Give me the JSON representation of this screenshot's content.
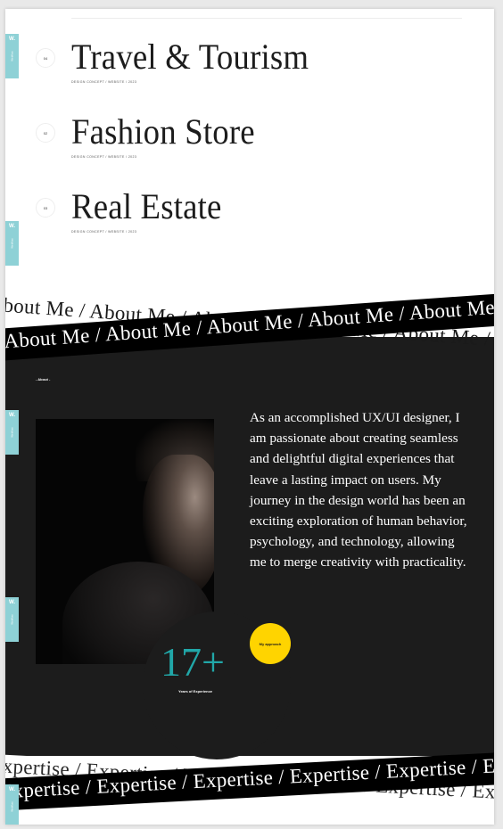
{
  "side_tab": {
    "logo": "W.",
    "label": "Webflow"
  },
  "projects": [
    {
      "number": "04",
      "title": "Travel & Tourism",
      "meta": "DESIGN CONCEPT  /  WEBSITE  /  2023"
    },
    {
      "number": "02",
      "title": "Fashion Store",
      "meta": "DESIGN CONCEPT  /  WEBSITE  /  2023"
    },
    {
      "number": "03",
      "title": "Real Estate",
      "meta": "DESIGN CONCEPT  /  WEBSITE  /  2023"
    }
  ],
  "about_band": {
    "front": "About Me  /  About Me  /  About Me  /  About Me  /  About Me  /  About Me",
    "back": "About Me  /  About Me  /  About Me  /  About Me  /  About Me  /  About Me"
  },
  "about": {
    "label": "- About -",
    "bio": "As an accomplished UX/UI designer, I am passionate about creating seamless and delightful digital experiences that leave a lasting impact on users. My journey in the design world has been an exciting exploration of human behavior, psychology, and technology, allowing me to merge creativity with practicality.",
    "button_label": "My approach",
    "years_value": "17+",
    "years_label": "Years of Experience",
    "photo_alt": "Portrait of designer"
  },
  "expertise_band": {
    "front": "Expertise  /  Expertise  /  Expertise  /  Expertise  /  Expertise  /  Expertise",
    "back": "Expertise  /  Expertise  /  Expertise  /  Expertise  /  Expertise  /  Expertise"
  },
  "colors": {
    "accent_teal": "#21a7a8",
    "button_yellow": "#ffd400",
    "dark_bg": "#1c1c1c",
    "side_tab": "#8ed1d6"
  }
}
